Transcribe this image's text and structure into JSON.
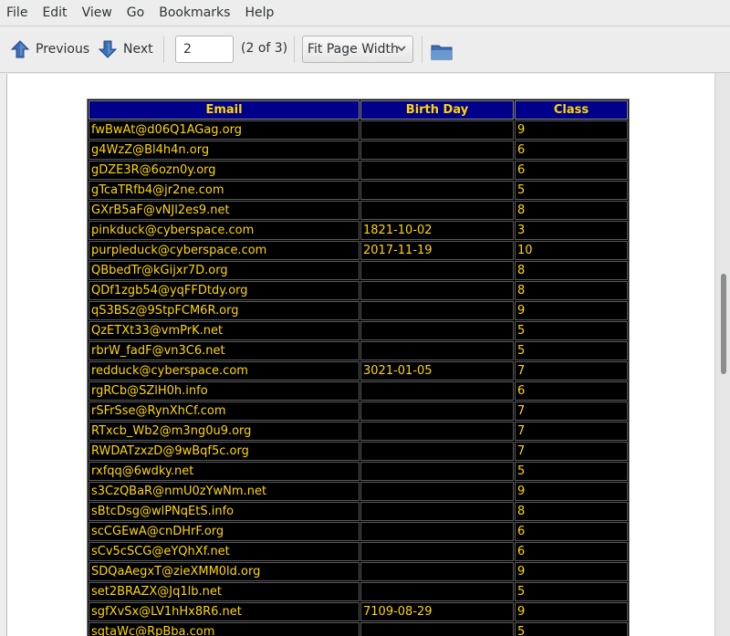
{
  "menu": [
    "File",
    "Edit",
    "View",
    "Go",
    "Bookmarks",
    "Help"
  ],
  "toolbar": {
    "previous_label": "Previous",
    "next_label": "Next",
    "page_value": "2",
    "page_count": "(2 of 3)",
    "zoom_value": "Fit Page Width"
  },
  "table": {
    "headers": [
      "Email",
      "Birth Day",
      "Class"
    ],
    "rows": [
      [
        "fwBwAt@d06Q1AGag.org",
        "",
        "9"
      ],
      [
        "g4WzZ@Bl4h4n.org",
        "",
        "6"
      ],
      [
        "gDZE3R@6ozn0y.org",
        "",
        "6"
      ],
      [
        "gTcaTRfb4@jr2ne.com",
        "",
        "5"
      ],
      [
        "GXrB5aF@vNJl2es9.net",
        "",
        "8"
      ],
      [
        "pinkduck@cyberspace.com",
        "1821-10-02",
        "3"
      ],
      [
        "purpleduck@cyberspace.com",
        "2017-11-19",
        "10"
      ],
      [
        "QBbedTr@kGijxr7D.org",
        "",
        "8"
      ],
      [
        "QDf1zgb54@yqFFDtdy.org",
        "",
        "8"
      ],
      [
        "qS3BSz@9StpFCM6R.org",
        "",
        "9"
      ],
      [
        "QzETXt33@vmPrK.net",
        "",
        "5"
      ],
      [
        "rbrW_fadF@vn3C6.net",
        "",
        "5"
      ],
      [
        "redduck@cyberspace.com",
        "3021-01-05",
        "7"
      ],
      [
        "rgRCb@SZlH0h.info",
        "",
        "6"
      ],
      [
        "rSFrSse@RynXhCf.com",
        "",
        "7"
      ],
      [
        "RTxcb_Wb2@m3ng0u9.org",
        "",
        "7"
      ],
      [
        "RWDATzxzD@9wBqf5c.org",
        "",
        "7"
      ],
      [
        "rxfqq@6wdky.net",
        "",
        "5"
      ],
      [
        "s3CzQBaR@nmU0zYwNm.net",
        "",
        "9"
      ],
      [
        "sBtcDsg@wlPNqEtS.info",
        "",
        "8"
      ],
      [
        "scCGEwA@cnDHrF.org",
        "",
        "6"
      ],
      [
        "sCv5cSCG@eYQhXf.net",
        "",
        "6"
      ],
      [
        "SDQaAegxT@zieXMM0ld.org",
        "",
        "9"
      ],
      [
        "set2BRAZX@Jq1lb.net",
        "",
        "5"
      ],
      [
        "sgfXvSx@LV1hHx8R6.net",
        "7109-08-29",
        "9"
      ],
      [
        "sgtaWc@RpBba.com",
        "",
        "5"
      ]
    ]
  }
}
